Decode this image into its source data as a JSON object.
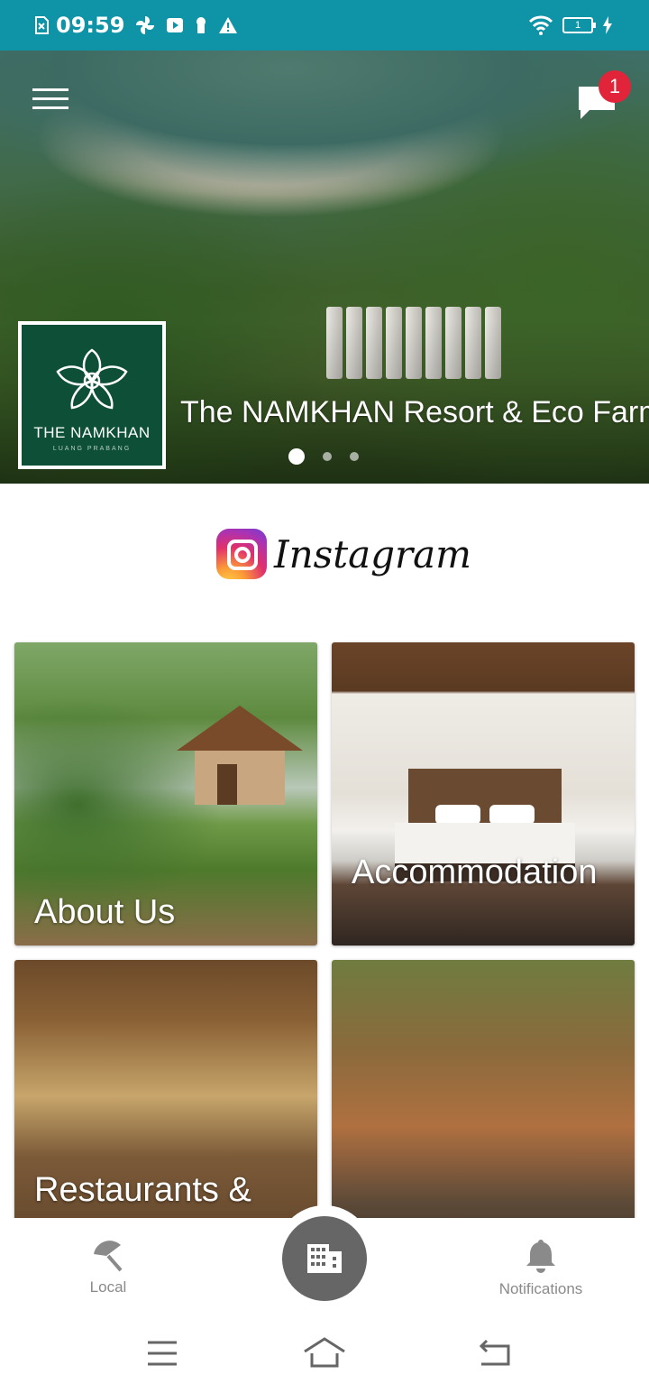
{
  "status_bar": {
    "time": "09:59",
    "battery_level": "1"
  },
  "header": {
    "chat_badge_count": "1"
  },
  "hero": {
    "title": "The NAMKHAN Resort & Eco Farm",
    "logo_title": "THE NAMKHAN",
    "logo_subtitle": "LUANG PRABANG",
    "slide_count": 3,
    "active_slide": 1
  },
  "instagram": {
    "label": "Instagram"
  },
  "tiles": [
    {
      "label": "About Us"
    },
    {
      "label": "Accommodation"
    },
    {
      "label": "Restaurants &"
    },
    {
      "label": ""
    }
  ],
  "bottom_nav": {
    "local_label": "Local",
    "notifications_label": "Notifications"
  },
  "colors": {
    "status_bar": "#0e93a7",
    "badge": "#e2243a",
    "logo_bg": "#0d4f37",
    "fab": "#666666",
    "nav_text": "#8a8a8a"
  },
  "icons": {
    "menu": "hamburger-icon",
    "chat": "chat-bubble-icon",
    "local": "beach-umbrella-icon",
    "center": "building-icon",
    "notifications": "bell-icon"
  }
}
